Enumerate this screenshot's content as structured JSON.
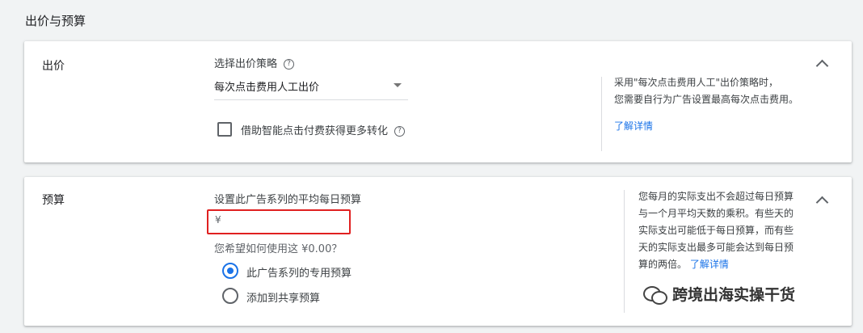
{
  "section": {
    "title": "出价与预算"
  },
  "bidding": {
    "title": "出价",
    "strategy_label": "选择出价策略",
    "strategy_help_icon": "help-circle-icon",
    "strategy_value": "每次点击费用人工出价",
    "enhanced_cpc_label": "借助智能点击付费获得更多转化",
    "enhanced_cpc_checked": false,
    "info_line1": "采用\"每次点击费用人工\"出价策略时，",
    "info_line2": "您需要自行为广告设置最高每次点击费用。",
    "learn_more": "了解详情",
    "collapse_icon": "chevron-up-icon"
  },
  "budget": {
    "title": "预算",
    "field_label": "设置此广告系列的平均每日预算",
    "currency_symbol": "¥",
    "input_value": "",
    "question": "您希望如何使用这 ¥0.00？",
    "options": [
      {
        "label": "此广告系列的专用预算",
        "selected": true
      },
      {
        "label": "添加到共享预算",
        "selected": false
      }
    ],
    "info_lines": [
      "您每月的实际支出不会超过每日预算",
      "与一个月平均天数的乘积。有些天的",
      "实际支出可能低于每日预算，而有些",
      "天的实际支出最多可能会达到每日预",
      "算的两倍。"
    ],
    "learn_more": "了解详情",
    "collapse_icon": "chevron-up-icon"
  },
  "watermark": {
    "text": "跨境出海实操干货",
    "icon": "wechat-logo-icon"
  },
  "colors": {
    "accent": "#1a73e8",
    "highlight_border": "#e02020",
    "background": "#f1f3f4"
  }
}
